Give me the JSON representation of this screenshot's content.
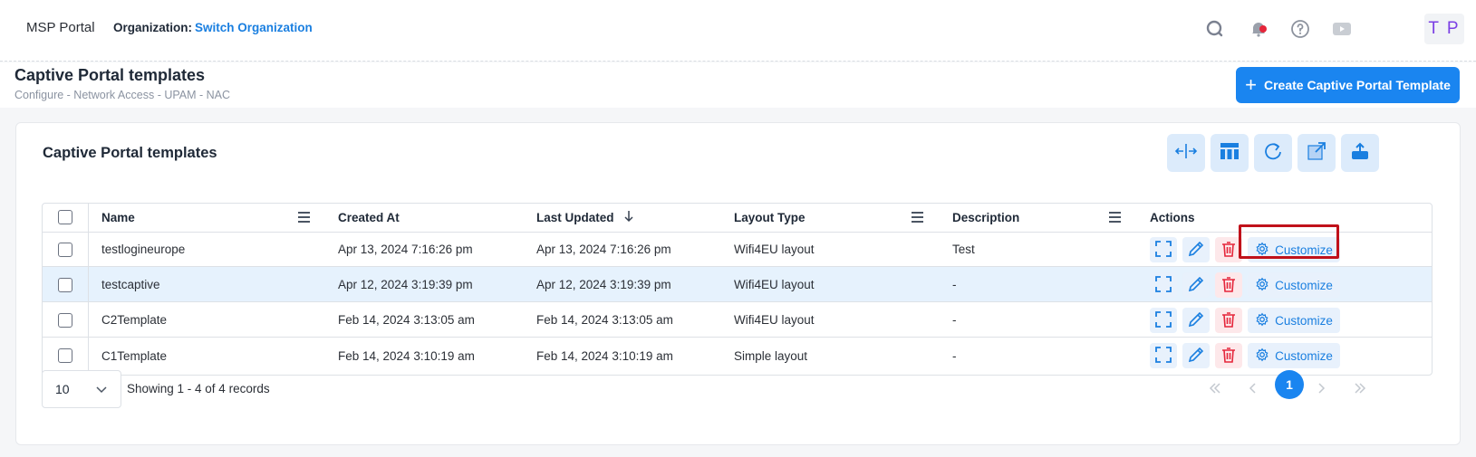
{
  "topbar": {
    "brand": "MSP Portal",
    "org_label": "Organization:",
    "org_link": "Switch Organization",
    "icons": [
      "search-icon",
      "notification-bell-icon",
      "help-icon",
      "video-icon"
    ],
    "avatar_initials": "T P",
    "colors": {
      "link": "#1a7fe0",
      "notification_dot": "#e5253a",
      "avatar_text": "#7b3fe4"
    }
  },
  "page": {
    "title": "Captive Portal templates",
    "breadcrumb": "Configure  -  Network Access  -  UPAM - NAC",
    "create_button": "Create Captive Portal Template"
  },
  "card": {
    "title": "Captive Portal templates",
    "toolbar_icons": [
      "column-resize-icon",
      "column-layout-icon",
      "refresh-icon",
      "open-external-icon",
      "export-icon"
    ]
  },
  "table": {
    "columns": [
      "Name",
      "Created At",
      "Last Updated",
      "Layout Type",
      "Description",
      "Actions"
    ],
    "sort_column": "Last Updated",
    "sort_direction": "desc",
    "rows": [
      {
        "name": "testlogineurope",
        "created": "Apr 13, 2024 7:16:26 pm",
        "updated": "Apr 13, 2024 7:16:26 pm",
        "layout": "Wifi4EU layout",
        "description": "Test"
      },
      {
        "name": "testcaptive",
        "created": "Apr 12, 2024 3:19:39 pm",
        "updated": "Apr 12, 2024 3:19:39 pm",
        "layout": "Wifi4EU layout",
        "description": "-"
      },
      {
        "name": "C2Template",
        "created": "Feb 14, 2024 3:13:05 am",
        "updated": "Feb 14, 2024 3:13:05 am",
        "layout": "Wifi4EU layout",
        "description": "-"
      },
      {
        "name": "C1Template",
        "created": "Feb 14, 2024 3:10:19 am",
        "updated": "Feb 14, 2024 3:10:19 am",
        "layout": "Simple layout",
        "description": "-"
      }
    ],
    "customize_label": "Customize",
    "selected_row": 1
  },
  "footer": {
    "page_size": "10",
    "records_text": "Showing 1 - 4 of 4 records",
    "current_page": "1"
  }
}
